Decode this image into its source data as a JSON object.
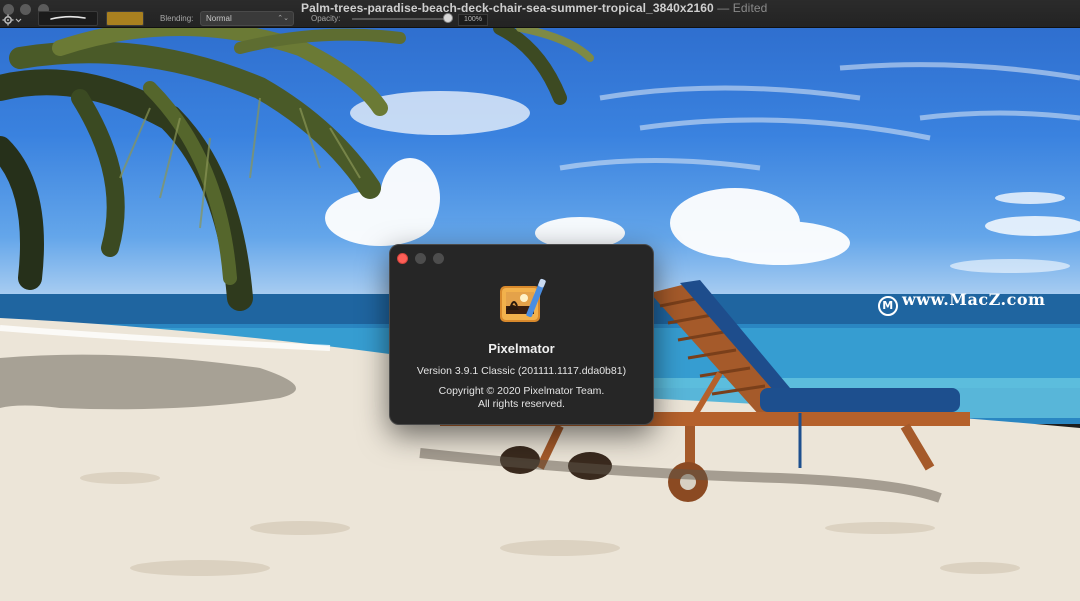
{
  "window": {
    "title": "Palm-trees-paradise-beach-deck-chair-sea-summer-tropical_3840x2160",
    "separator": "—",
    "status": "Edited"
  },
  "toolbar": {
    "swatch_color": "#a9801f",
    "blending_label": "Blending:",
    "blending_value": "Normal",
    "opacity_label": "Opacity:",
    "opacity_value": "100%",
    "opacity_level": 1.0
  },
  "canvas": {
    "watermark": "www.MacZ.com",
    "watermark_logo": "M"
  },
  "about": {
    "app_name": "Pixelmator",
    "version": "Version 3.9.1 Classic (201111.1117.dda0b81)",
    "copyright": "Copyright © 2020 Pixelmator Team.",
    "rights": "All rights reserved.",
    "close_color": "#fe5f57"
  }
}
